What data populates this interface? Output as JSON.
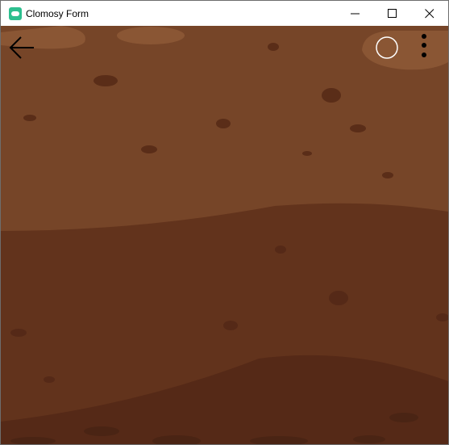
{
  "window": {
    "title": "Clomosy Form",
    "app_icon": "clomosy-cloud-icon",
    "controls": [
      "minimize-icon",
      "maximize-icon",
      "close-icon"
    ]
  },
  "toolbar": {
    "back_icon": "arrow-left-icon",
    "action_icon": "circle-icon",
    "menu_icon": "more-vertical-icon"
  },
  "background": {
    "name": "dirt-terrain",
    "colors": {
      "top_layer": "#764528",
      "middle_layer": "#62331c",
      "bottom_layer": "#552917",
      "highlight_patch": "#8a5634",
      "rock": "#5a2d18"
    }
  }
}
